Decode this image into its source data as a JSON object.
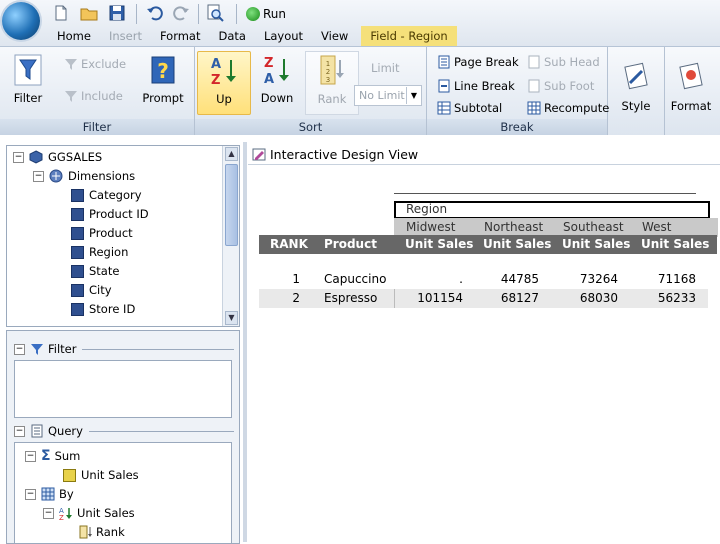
{
  "menu_tabs": [
    {
      "label": "Home"
    },
    {
      "label": "Insert",
      "disabled": true
    },
    {
      "label": "Format"
    },
    {
      "label": "Data"
    },
    {
      "label": "Layout"
    },
    {
      "label": "View"
    },
    {
      "label": "Field - Region",
      "contextual": true
    }
  ],
  "quick_access": {
    "run_label": "Run",
    "icons": [
      "new-icon",
      "open-icon",
      "save-icon",
      "undo-icon",
      "redo-icon",
      "preview-icon"
    ]
  },
  "ribbon": {
    "filter_group": {
      "label": "Filter",
      "filter": "Filter",
      "exclude": "Exclude",
      "include": "Include",
      "prompt": "Prompt"
    },
    "sort_group": {
      "label": "Sort",
      "up": "Up",
      "down": "Down",
      "rank": "Rank",
      "limit": "Limit",
      "limit_value": "No Limit"
    },
    "break_group": {
      "label": "Break",
      "page_break": "Page Break",
      "line_break": "Line Break",
      "subtotal": "Subtotal",
      "sub_head": "Sub Head",
      "sub_foot": "Sub Foot",
      "recompute": "Recompute"
    },
    "style": "Style",
    "format": "Format"
  },
  "tree": {
    "root": "GGSALES",
    "dimensions_label": "Dimensions",
    "fields": [
      "Category",
      "Product ID",
      "Product",
      "Region",
      "State",
      "City",
      "Store ID"
    ]
  },
  "filter_panel": {
    "title": "Filter"
  },
  "query_panel": {
    "title": "Query",
    "sum_label": "Sum",
    "sum_field": "Unit Sales",
    "by_label": "By",
    "by_field": "Unit Sales",
    "by_sub": "Rank"
  },
  "design_view": {
    "title": "Interactive Design View",
    "region_header": "Region",
    "rank_header": "RANK",
    "product_header": "Product",
    "regions": [
      "Midwest",
      "Northeast",
      "Southeast",
      "West"
    ],
    "measure": "Unit Sales",
    "rows": [
      {
        "rank": "1",
        "product": "Capuccino",
        "values": [
          ".",
          "44785",
          "73264",
          "71168"
        ]
      },
      {
        "rank": "2",
        "product": "Espresso",
        "values": [
          "101154",
          "68127",
          "68030",
          "56233"
        ]
      }
    ]
  }
}
